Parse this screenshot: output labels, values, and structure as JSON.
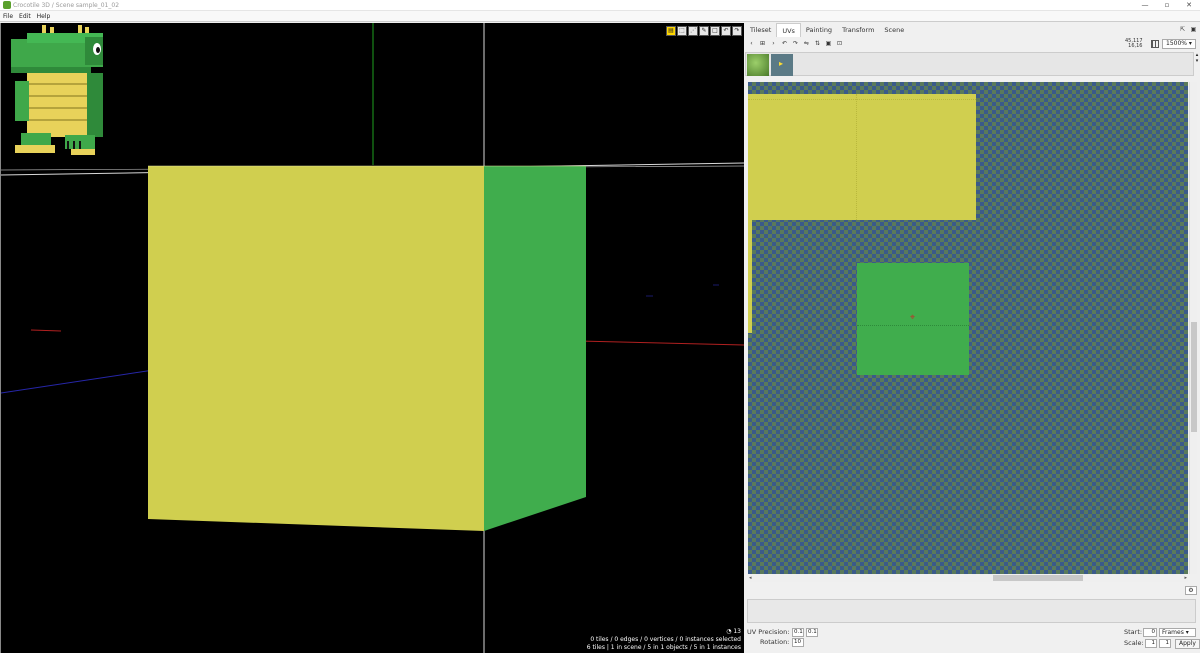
{
  "window": {
    "title": "Crocotile 3D / Scene sample_01_02",
    "minimize_icon": "minimize-icon",
    "maximize_icon": "restore-icon",
    "close_icon": "close-icon"
  },
  "menu": {
    "file": "File",
    "edit": "Edit",
    "help": "Help"
  },
  "viewport": {
    "fps": "13",
    "status_line_1": "0 tiles / 0 edges / 0 vertices / 0 instances selected",
    "status_line_2": "6 tiles | 1 in scene / 5 in 1 objects / 5 in 1 instances",
    "cube_front_color": "#d0cf4f",
    "cube_side_color": "#40ad4d",
    "toolbar_icons": [
      "draw-tool-icon",
      "select-tool-icon",
      "vertex-tool-icon",
      "edge-tool-icon",
      "box-tool-icon",
      "undo-icon",
      "redo-icon"
    ]
  },
  "panel": {
    "tabs": [
      "Tileset",
      "UVs",
      "Painting",
      "Transform",
      "Scene"
    ],
    "active_tab": "UVs",
    "coords_line_1": "45,117",
    "coords_line_2": "16,16",
    "zoom": "1500%",
    "uv_precision_label": "UV Precision:",
    "uv_precision_x": "0.1",
    "uv_precision_y": "0.1",
    "rotation_label": "Rotation:",
    "rotation_value": "10",
    "start_label": "Start:",
    "start_value": "0",
    "frames_option": "Frames",
    "scale_label": "Scale:",
    "scale_x": "1",
    "scale_y": "1",
    "apply_label": "Apply"
  }
}
